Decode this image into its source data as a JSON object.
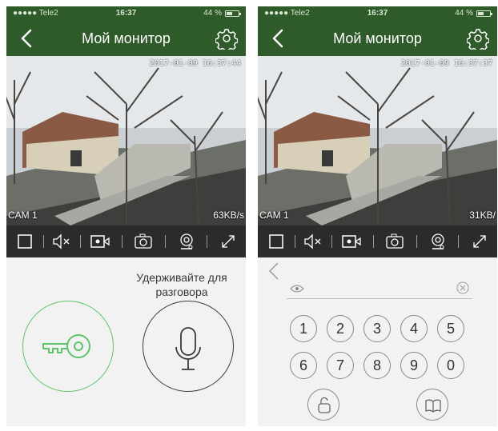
{
  "status_bar": {
    "carrier": "●●●●● Tele2",
    "time": "16:37",
    "battery": "44 %"
  },
  "header": {
    "title": "Мой монитор"
  },
  "left": {
    "camera": {
      "timestamp": "2017-01-09 16:37:44",
      "label": "CAM 1",
      "bitrate": "63KB/s"
    },
    "talk_hint": {
      "line1": "Удерживайте для",
      "line2": "разговора"
    }
  },
  "right": {
    "camera": {
      "timestamp": "2017-01-09 16:37:37",
      "label": "CAM 1",
      "bitrate": "31KB/"
    },
    "keypad": {
      "keys": [
        "1",
        "2",
        "3",
        "4",
        "5",
        "6",
        "7",
        "8",
        "9",
        "0"
      ]
    }
  },
  "icons": {
    "back": "chevron-left-icon",
    "settings": "gear-icon",
    "record": "square-icon",
    "mute": "speaker-mute-icon",
    "video": "video-camera-icon",
    "snapshot": "camera-icon",
    "playback": "playback-icon",
    "fullscreen": "expand-icon",
    "key": "key-icon",
    "mic": "microphone-icon",
    "eye": "eye-icon",
    "clear": "clear-icon",
    "unlock": "padlock-icon",
    "book": "book-icon"
  },
  "colors": {
    "header_green": "#2f5a2a",
    "toolbar": "#2b2b2b",
    "unlock_green": "#5cc46a",
    "background": "#f2f2f2"
  }
}
